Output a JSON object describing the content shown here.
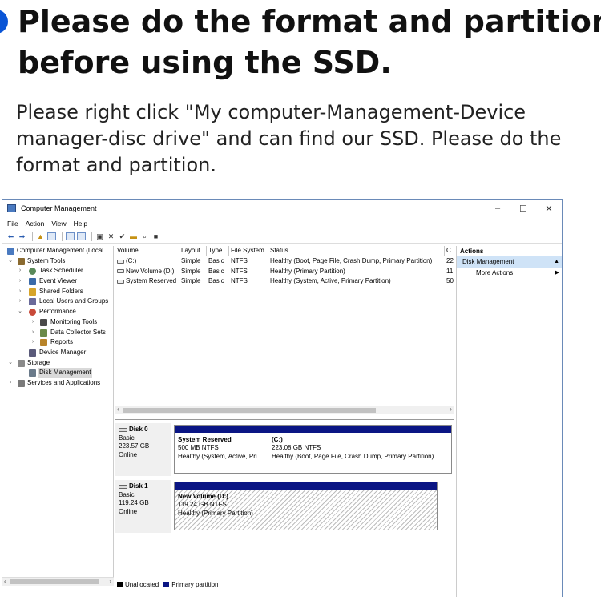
{
  "heading": {
    "title_line1": "Please do the format and partition",
    "title_line2": "before using the SSD.",
    "description": "Please right click \"My computer-Management-Device manager-disc drive\" and can find our SSD. Please do the format and partition."
  },
  "window": {
    "title": "Computer Management",
    "buttons": {
      "minimize": "–",
      "maximize": "☐",
      "close": "✕"
    },
    "menu": [
      "File",
      "Action",
      "View",
      "Help"
    ],
    "tree": [
      {
        "label": "Computer Management (Local",
        "twisty": "",
        "icon": "computer-icon",
        "color": "#4a7ac0"
      },
      {
        "label": "System Tools",
        "twisty": "⌄",
        "icon": "tools-icon",
        "color": "#8a6a30"
      },
      {
        "label": "Task Scheduler",
        "twisty": "›",
        "icon": "clock-icon",
        "color": "#5a8a5a"
      },
      {
        "label": "Event Viewer",
        "twisty": "›",
        "icon": "event-viewer-icon",
        "color": "#3a6aa8"
      },
      {
        "label": "Shared Folders",
        "twisty": "›",
        "icon": "folder-icon",
        "color": "#d6a42a"
      },
      {
        "label": "Local Users and Groups",
        "twisty": "›",
        "icon": "users-icon",
        "color": "#6a6a9a"
      },
      {
        "label": "Performance",
        "twisty": "⌄",
        "icon": "performance-icon",
        "color": "#c84a3a"
      },
      {
        "label": "Monitoring Tools",
        "twisty": "›",
        "icon": "monitoring-icon",
        "color": "#4a4a4a"
      },
      {
        "label": "Data Collector Sets",
        "twisty": "›",
        "icon": "data-collector-icon",
        "color": "#6a8a4a"
      },
      {
        "label": "Reports",
        "twisty": "›",
        "icon": "reports-icon",
        "color": "#b8842a"
      },
      {
        "label": "Device Manager",
        "twisty": "",
        "icon": "device-manager-icon",
        "color": "#5a5a7a"
      },
      {
        "label": "Storage",
        "twisty": "⌄",
        "icon": "storage-icon",
        "color": "#8a8a8a"
      },
      {
        "label": "Disk Management",
        "twisty": "",
        "icon": "disk-management-icon",
        "color": "#6a7a8a"
      },
      {
        "label": "Services and Applications",
        "twisty": "›",
        "icon": "services-icon",
        "color": "#7a7a7a"
      }
    ],
    "volume_list": {
      "headers": [
        "Volume",
        "Layout",
        "Type",
        "File System",
        "Status",
        "C"
      ],
      "rows": [
        [
          "(C:)",
          "Simple",
          "Basic",
          "NTFS",
          "Healthy (Boot, Page File, Crash Dump, Primary Partition)",
          "22"
        ],
        [
          "New Volume (D:)",
          "Simple",
          "Basic",
          "NTFS",
          "Healthy (Primary Partition)",
          "11"
        ],
        [
          "System Reserved",
          "Simple",
          "Basic",
          "NTFS",
          "Healthy (System, Active, Primary Partition)",
          "50"
        ]
      ]
    },
    "disks": [
      {
        "name": "Disk 0",
        "type": "Basic",
        "size": "223.57 GB",
        "status": "Online",
        "partitions": [
          {
            "name": "System Reserved",
            "size": "500 MB NTFS",
            "status": "Healthy (System, Active, Pri"
          },
          {
            "name": "(C:)",
            "size": "223.08 GB NTFS",
            "status": "Healthy (Boot, Page File, Crash Dump, Primary Partition)"
          }
        ]
      },
      {
        "name": "Disk 1",
        "type": "Basic",
        "size": "119.24 GB",
        "status": "Online",
        "partitions": [
          {
            "name": "New Volume (D:)",
            "size": "119.24 GB NTFS",
            "status": "Healthy (Primary Partition)"
          }
        ]
      }
    ],
    "legend": [
      {
        "label": "Unallocated",
        "color": "#000000"
      },
      {
        "label": "Primary partition",
        "color": "#0a1584"
      }
    ],
    "actions": {
      "header": "Actions",
      "section": "Disk Management",
      "more": "More Actions"
    }
  },
  "colors": {
    "accent": "#0a55d6",
    "partition_bar": "#0a1584",
    "selection": "#cfe3f7"
  }
}
